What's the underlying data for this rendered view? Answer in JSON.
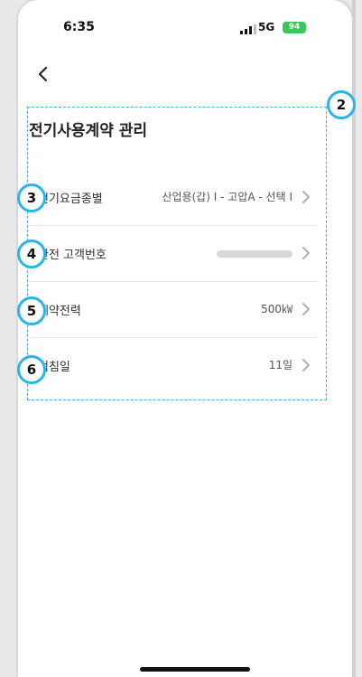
{
  "status_bar": {
    "time": "6:35",
    "network": "5G",
    "battery": "94"
  },
  "page": {
    "title": "전기사용계약 관리"
  },
  "rows": [
    {
      "label": "전기요금종별",
      "value": "산업용(갑) Ⅰ - 고압A - 선택 Ⅰ"
    },
    {
      "label": "한전 고객번호",
      "value": ""
    },
    {
      "label": "계약전력",
      "value": "500㎾"
    },
    {
      "label": "검침일",
      "value": "11일"
    }
  ],
  "callouts": [
    "2",
    "3",
    "4",
    "5",
    "6"
  ],
  "colors": {
    "callout_border": "#2ab5ea",
    "panel_border": "#4aa8e0",
    "battery": "#38c759"
  }
}
